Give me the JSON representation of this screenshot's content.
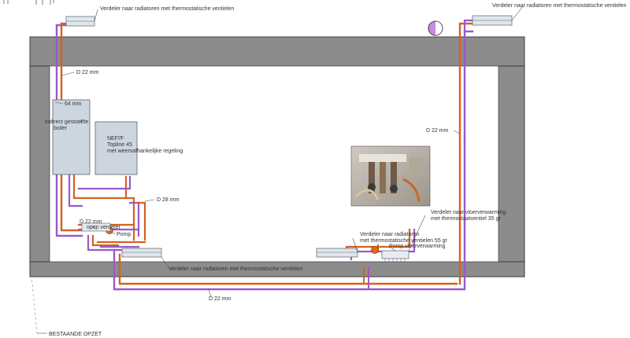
{
  "labels": {
    "dist_top_left": "Verdeler naar radiatoren met thermostatische ventielen",
    "dist_top_right": "Verdeler naar radiatoren met thermostatische ventielen",
    "d22_left": "D 22 mm",
    "d22_right": "D 22 mm",
    "d22_bottom": "D 22 mm",
    "d28": "D 28 mm",
    "d22_pump": "D 22 mm",
    "dim_64": "64 mm",
    "boiler_line1": "Indirect gestookte",
    "boiler_line2": "boiler",
    "nefit_line1": "NEFIT",
    "nefit_line2": "Topline 45",
    "nefit_line3": "met weersafhankelijke regeling",
    "open_verdeler": "open verdeler",
    "pomp_left": "Pomp",
    "dist_bottom_left": "Verdeler naar radiatoren met thermostatische ventielen",
    "dist_bottom_mid_line1": "Verdeler naar radiatoren",
    "dist_bottom_mid_line2": "met thermostatische ventielen 55 gr",
    "pomp_floor": "Pomp vloerverwarming",
    "dist_floor_line1": "Verdeler naar vloerverwarming",
    "dist_floor_line2": "met thermostaatventiel 35 gr",
    "existing": "BESTAANDE OPZET"
  },
  "colors": {
    "wall": "#8c8c8c",
    "wall_edge": "#3a3a3a",
    "pipe_supply": "#d4621e",
    "pipe_return": "#9b59c7",
    "equipment": "#cdd6df",
    "pump_accent": "#e26a1b"
  },
  "photo": {
    "icon": "photo-manifold-icon"
  }
}
